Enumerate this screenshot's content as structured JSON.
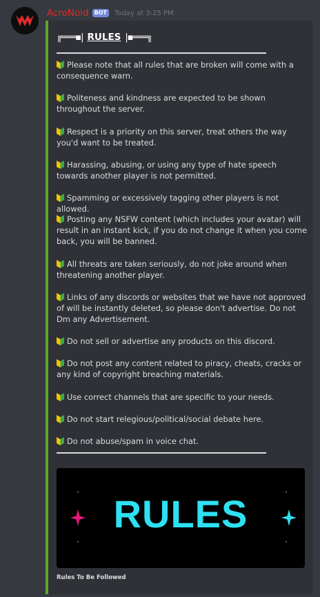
{
  "message": {
    "username": "AcroNoid",
    "bot_tag": "BOT",
    "timestamp": "Today at 3:25 PM",
    "username_color": "#e02b2b"
  },
  "embed": {
    "border_color": "#5fa728",
    "title_left_ornament": "╔═══▪|",
    "title": "RULES",
    "title_right_ornament": "|▪═══╗",
    "rule_icon": "beginner-shield-icon",
    "rules": [
      "Please note that all rules that are broken will come with a consequence warn.",
      "Politeness and kindness are expected to be shown throughout the server.",
      "Respect is a priority on this server, treat others the way you'd want to be treated.",
      "Harassing, abusing, or using any type of hate speech towards another player is not permitted.",
      "Spamming or excessively tagging other players is not allowed.",
      "Posting any NSFW content (which includes your avatar) will result in an instant kick, if you do not change it when you come back, you will be banned.",
      "All threats are taken seriously, do not joke around when threatening another player.",
      "Links of any discords or websites that we have not approved of will be instantly deleted, so please don't advertise. Do not Dm any Advertisement.",
      "Do not sell or advertise any products on this discord.",
      "Do not post any content related to piracy, cheats, cracks or any kind of copyright breaching materials.",
      "Use correct channels that are specific to your needs.",
      "Do not start relegious/political/social debate here.",
      "Do not abuse/spam in voice chat."
    ],
    "image_text": "RULES",
    "image_text_color": "#2ee0f2",
    "footer": "Rules To Be Followed"
  }
}
